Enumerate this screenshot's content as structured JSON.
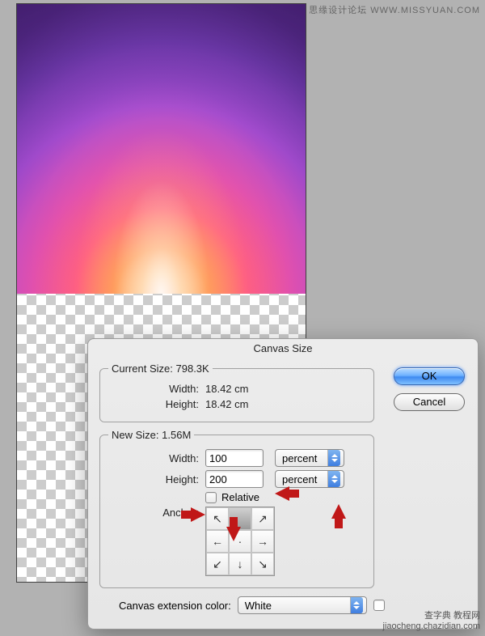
{
  "watermark": {
    "top": "思缘设计论坛  WWW.MISSYUAN.COM",
    "bottom_cn": "查字典  教程网",
    "bottom_url": "jiaocheng.chazidian.com"
  },
  "dialog": {
    "title": "Canvas Size",
    "current": {
      "legend": "Current Size:",
      "size": "798.3K",
      "width_label": "Width:",
      "width_val": "18.42 cm",
      "height_label": "Height:",
      "height_val": "18.42 cm"
    },
    "new": {
      "legend": "New Size:",
      "size": "1.56M",
      "width_label": "Width:",
      "width_val": "100",
      "width_unit": "percent",
      "height_label": "Height:",
      "height_val": "200",
      "height_unit": "percent",
      "relative_label": "Relative",
      "relative_checked": false,
      "anchor_label": "Anchor:"
    },
    "extension": {
      "label": "Canvas extension color:",
      "value": "White"
    },
    "buttons": {
      "ok": "OK",
      "cancel": "Cancel"
    }
  },
  "anchor": {
    "selected": 1,
    "glyphs": [
      "↖",
      "",
      "↗",
      "←",
      "·",
      "→",
      "↙",
      "↓",
      "↘"
    ]
  }
}
